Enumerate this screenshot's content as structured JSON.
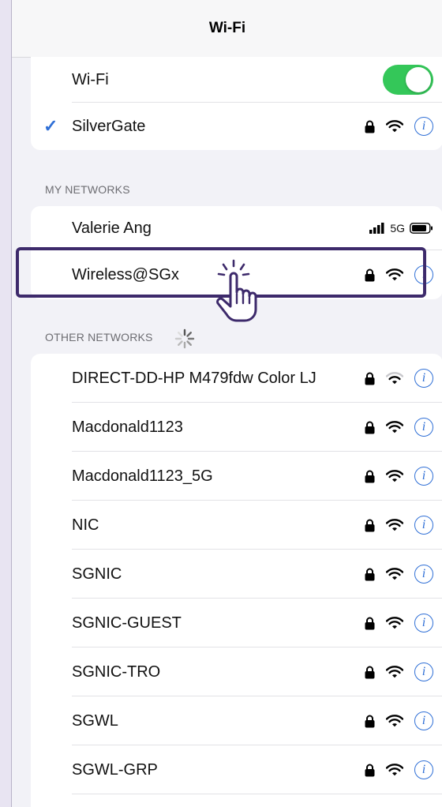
{
  "nav": {
    "title": "Wi-Fi"
  },
  "top": {
    "wifi_label": "Wi-Fi",
    "wifi_on": true,
    "connected_network": "SilverGate"
  },
  "my_networks": {
    "header": "MY NETWORKS",
    "hotspot": {
      "name": "Valerie Ang",
      "network_type": "5G"
    },
    "items": [
      {
        "name": "Wireless@SGx"
      }
    ]
  },
  "other_networks": {
    "header": "OTHER NETWORKS",
    "items": [
      {
        "name": "DIRECT-DD-HP M479fdw Color LJ"
      },
      {
        "name": "Macdonald1123"
      },
      {
        "name": "Macdonald1123_5G"
      },
      {
        "name": "NIC"
      },
      {
        "name": "SGNIC"
      },
      {
        "name": "SGNIC-GUEST"
      },
      {
        "name": "SGNIC-TRO"
      },
      {
        "name": "SGWL"
      },
      {
        "name": "SGWL-GRP"
      }
    ]
  },
  "colors": {
    "accent": "#2f6fd6",
    "toggle_on": "#34c759",
    "highlight": "#3d2a6b"
  },
  "icons": {
    "lock": "lock-icon",
    "wifi": "wifi-icon",
    "info": "info-icon",
    "check": "checkmark-icon",
    "hand": "tap-hand-icon"
  }
}
